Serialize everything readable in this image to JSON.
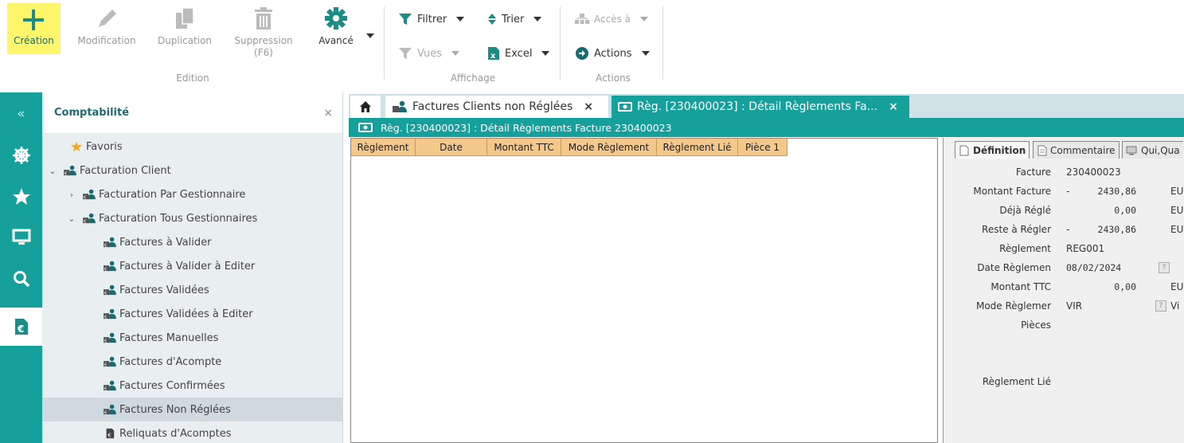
{
  "ribbon": {
    "creation": "Création",
    "modification": "Modification",
    "duplication": "Duplication",
    "suppression": "Suppression",
    "suppression_key": "(F6)",
    "avance": "Avancé",
    "group_edition": "Edition",
    "filtrer": "Filtrer",
    "trier": "Trier",
    "vues": "Vues",
    "excel": "Excel",
    "group_affichage": "Affichage",
    "acces": "Accès à",
    "actions": "Actions",
    "group_actions": "Actions"
  },
  "sidebar": {
    "collapse": "«"
  },
  "tree": {
    "title": "Comptabilité",
    "close": "×",
    "items": [
      {
        "label": "Favoris"
      },
      {
        "label": "Facturation Client"
      },
      {
        "label": "Facturation Par Gestionnaire"
      },
      {
        "label": "Facturation Tous Gestionnaires"
      },
      {
        "label": "Factures à Valider"
      },
      {
        "label": "Factures à Valider à Editer"
      },
      {
        "label": "Factures Validées"
      },
      {
        "label": "Factures Validées à Editer"
      },
      {
        "label": "Factures Manuelles"
      },
      {
        "label": "Factures d'Acompte"
      },
      {
        "label": "Factures Confirmées"
      },
      {
        "label": "Factures Non Réglées"
      },
      {
        "label": "Reliquats d'Acomptes"
      }
    ]
  },
  "tabs": [
    {
      "label": "Factures Clients non Réglées",
      "close": "×"
    },
    {
      "label": "Règ. [230400023] : Détail Règlements Fa...",
      "close": "×"
    }
  ],
  "breadcrumb": "Règ. [230400023] : Détail Règlements Facture 230400023",
  "grid": {
    "columns": [
      "Règlement",
      "Date",
      "Montant TTC",
      "Mode Règlement",
      "Règlement Lié",
      "Pièce 1"
    ]
  },
  "detail": {
    "tabs": [
      "Définition",
      "Commentaire",
      "Qui,Qua"
    ],
    "facture_label": "Facture",
    "facture_value": "230400023",
    "montant_facture_label": "Montant Facture",
    "montant_facture_sign": "-",
    "montant_facture_value": "2430,86",
    "montant_facture_cur": "EU",
    "deja_regle_label": "Déjà Réglé",
    "deja_regle_value": "0,00",
    "deja_regle_cur": "EU",
    "reste_label": "Reste à Régler",
    "reste_sign": "-",
    "reste_value": "2430,86",
    "reste_cur": "EU",
    "reglement_label": "Règlement",
    "reglement_value": "REG001",
    "date_label": "Date Règlemen",
    "date_value": "08/02/2024",
    "help": "?",
    "montant_ttc_label": "Montant TTC",
    "montant_ttc_value": "0,00",
    "montant_ttc_cur": "EU",
    "mode_label": "Mode Règlemer",
    "mode_value": "VIR",
    "mode_extra": "Vi",
    "pieces_label": "Pièces",
    "reglement_lie_label": "Règlement Lié"
  }
}
